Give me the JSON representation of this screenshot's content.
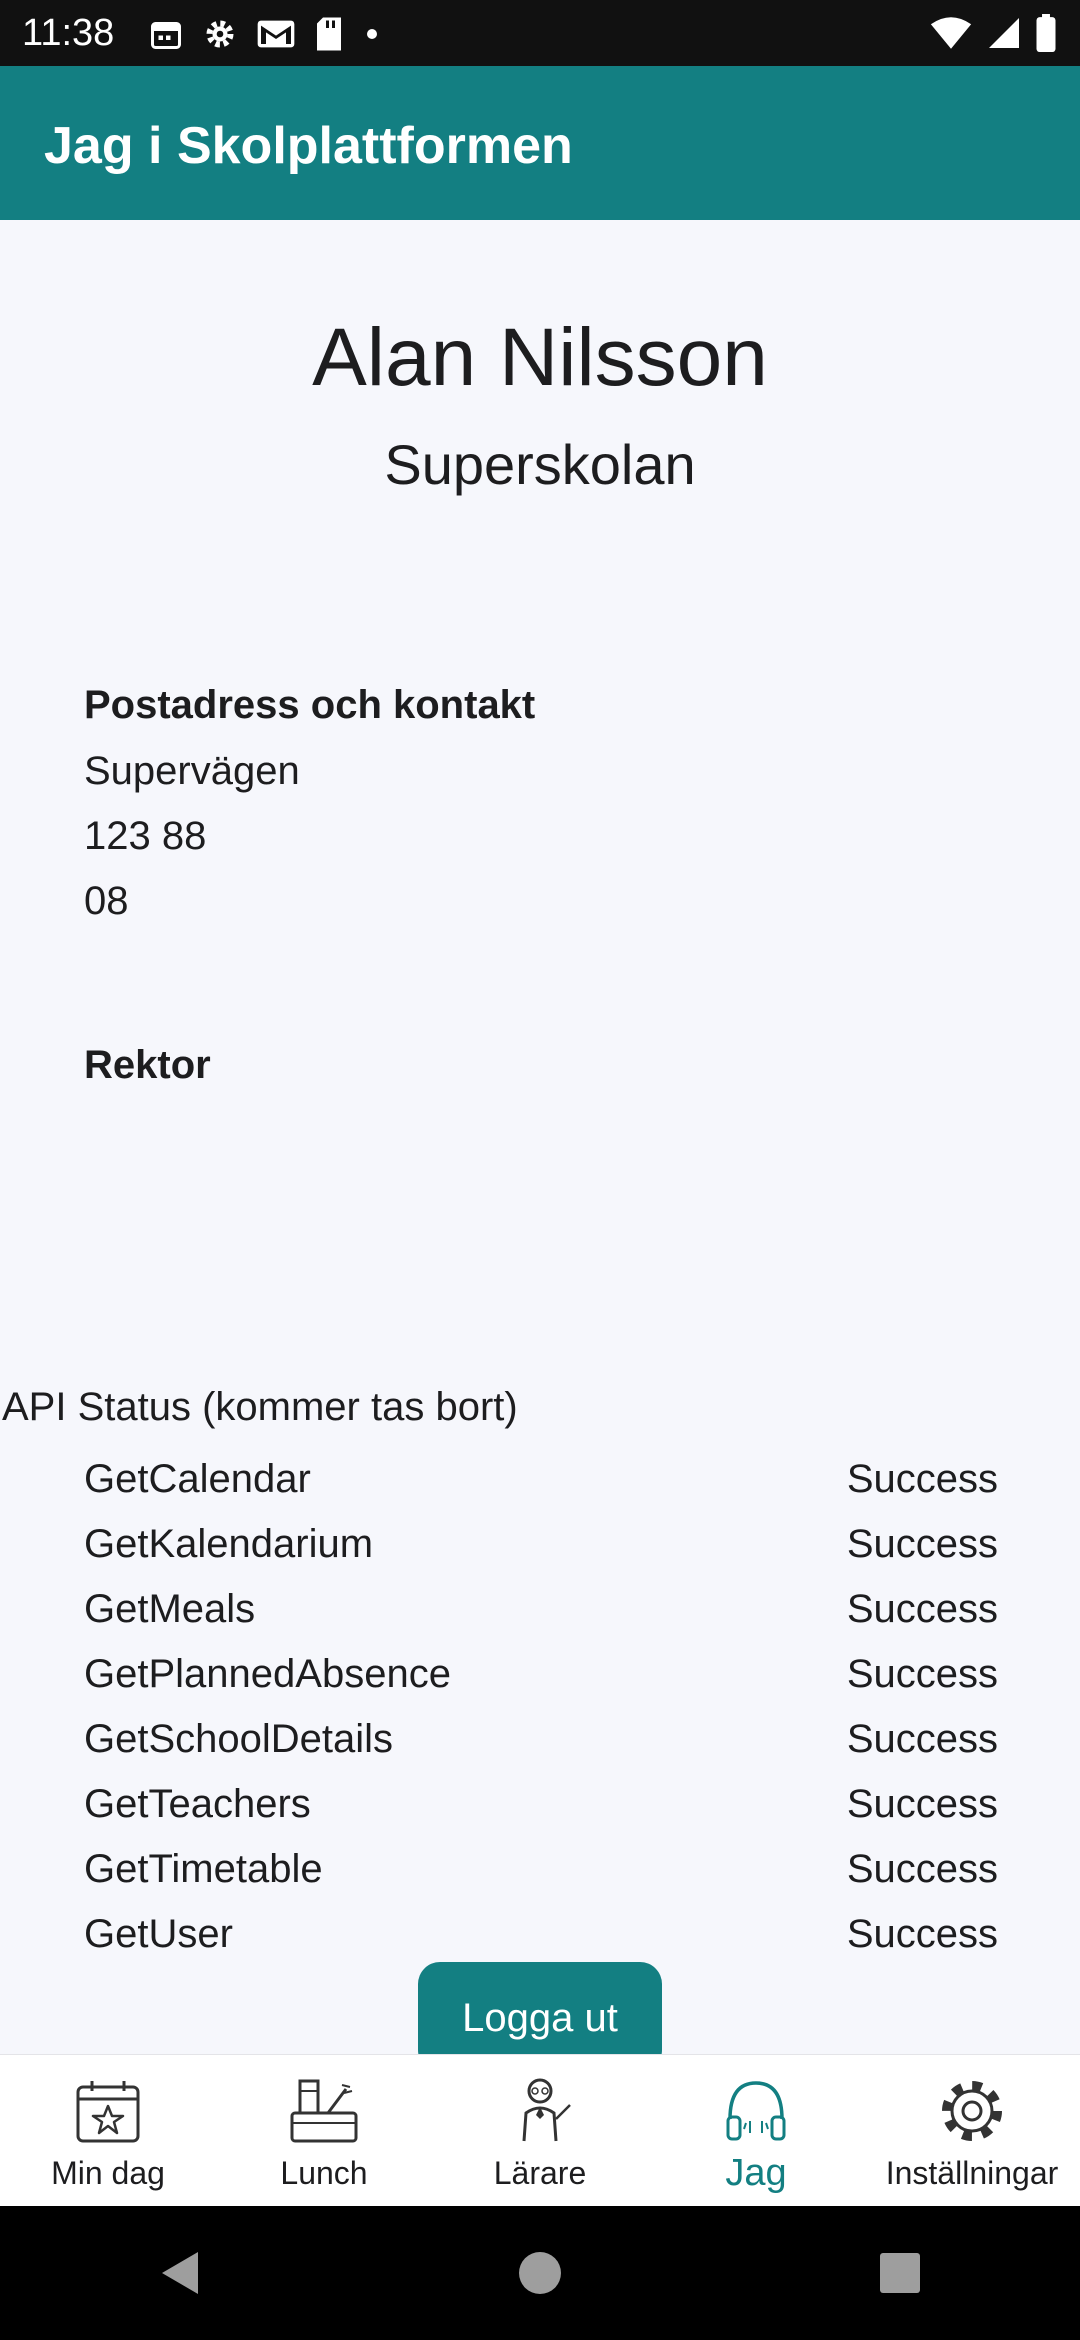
{
  "status_bar": {
    "time": "11:38",
    "left_icons": [
      "calendar-icon",
      "gear-icon",
      "gmail-icon",
      "sd-card-icon",
      "dot-icon"
    ],
    "right_icons": [
      "wifi-icon",
      "signal-icon",
      "battery-icon"
    ]
  },
  "app_bar": {
    "title": "Jag i Skolplattformen",
    "color": "#137f82"
  },
  "profile": {
    "name": "Alan Nilsson",
    "school": "Superskolan"
  },
  "contact": {
    "heading": "Postadress och kontakt",
    "lines": [
      "Supervägen",
      "123 88",
      "08"
    ]
  },
  "principal": {
    "heading": "Rektor"
  },
  "api_status": {
    "title": "API Status (kommer tas bort)",
    "rows": [
      {
        "name": "GetCalendar",
        "status": "Success"
      },
      {
        "name": "GetKalendarium",
        "status": "Success"
      },
      {
        "name": "GetMeals",
        "status": "Success"
      },
      {
        "name": "GetPlannedAbsence",
        "status": "Success"
      },
      {
        "name": "GetSchoolDetails",
        "status": "Success"
      },
      {
        "name": "GetTeachers",
        "status": "Success"
      },
      {
        "name": "GetTimetable",
        "status": "Success"
      },
      {
        "name": "GetUser",
        "status": "Success"
      }
    ]
  },
  "logout_label": "Logga ut",
  "bottom_nav": {
    "active": "Jag",
    "items": [
      {
        "label": "Min dag",
        "icon": "calendar-star-icon"
      },
      {
        "label": "Lunch",
        "icon": "lunch-icon"
      },
      {
        "label": "Lärare",
        "icon": "teacher-icon"
      },
      {
        "label": "Jag",
        "icon": "headphones-icon"
      },
      {
        "label": "Inställningar",
        "icon": "gear-icon"
      }
    ]
  },
  "system_nav": [
    "back-icon",
    "home-icon",
    "recents-icon"
  ]
}
